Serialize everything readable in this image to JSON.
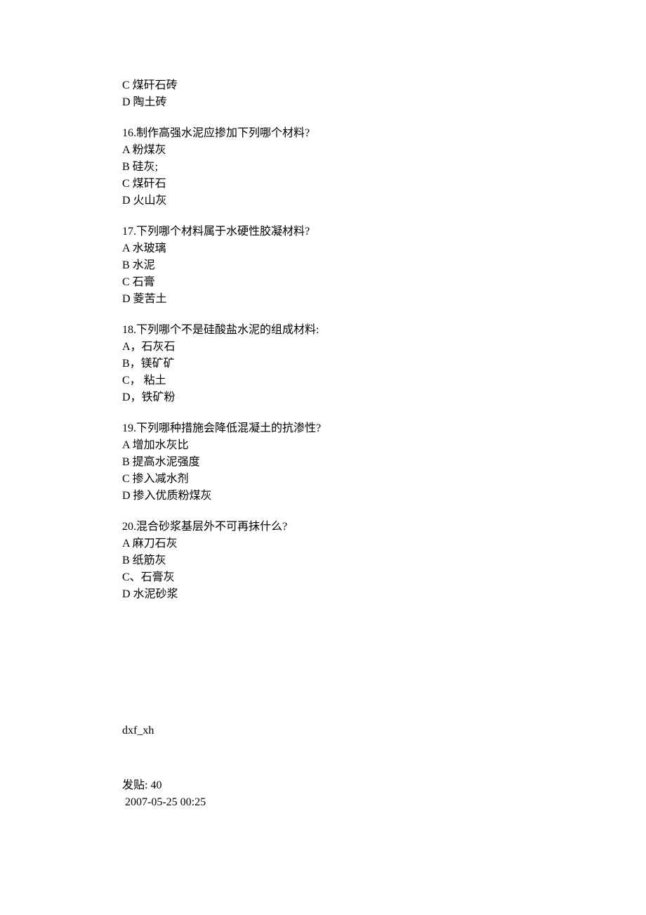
{
  "topLines": [
    "C 煤矸石砖",
    "D 陶土砖"
  ],
  "questions": [
    {
      "title": "16.制作高强水泥应掺加下列哪个材料?",
      "opts": [
        "A 粉煤灰",
        "B 硅灰;",
        "C 煤矸石",
        "D 火山灰"
      ]
    },
    {
      "title": "17.下列哪个材料属于水硬性胶凝材料?",
      "opts": [
        "A 水玻璃",
        "B 水泥",
        "C 石膏",
        "D 菱苦土"
      ]
    },
    {
      "title": "18.下列哪个不是硅酸盐水泥的组成材料:",
      "opts": [
        "A，石灰石",
        "B，镁矿矿",
        "C， 粘土",
        "D，铁矿粉"
      ]
    },
    {
      "title": "19.下列哪种措施会降低混凝土的抗渗性?",
      "opts": [
        "A 增加水灰比",
        "B 提高水泥强度",
        "C 掺入减水剂",
        "D 掺入优质粉煤灰"
      ]
    },
    {
      "title": "20.混合砂浆基层外不可再抹什么?",
      "opts": [
        "A 麻刀石灰",
        "B 纸筋灰",
        "C、石膏灰",
        "D 水泥砂浆"
      ]
    }
  ],
  "meta": {
    "user": "dxf_xh",
    "postLabel": "发贴: 40",
    "timestamp": " 2007-05-25 00:25"
  }
}
